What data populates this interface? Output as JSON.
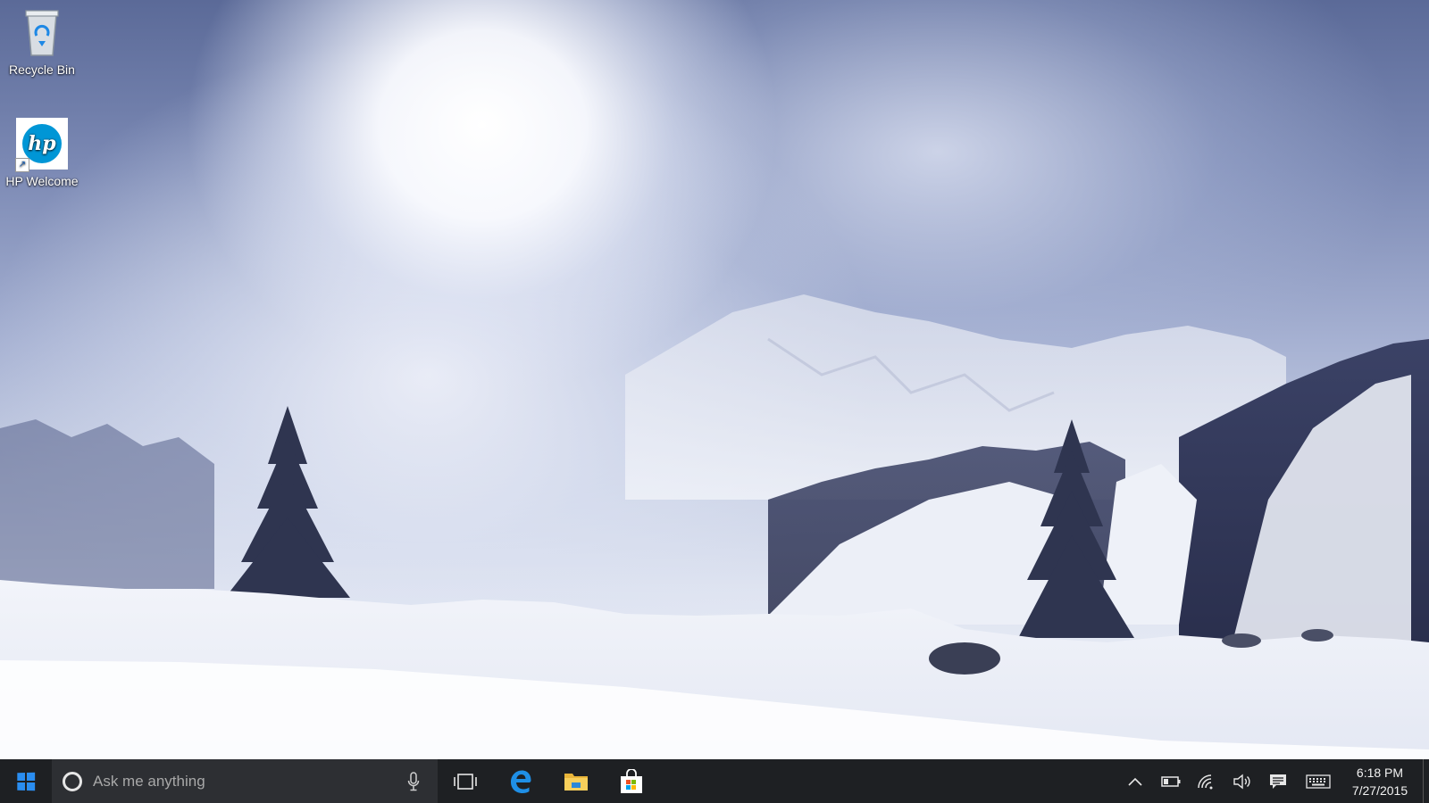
{
  "desktop": {
    "icons": [
      {
        "label": "Recycle Bin",
        "icon": "recycle-bin-icon"
      },
      {
        "label": "HP Welcome",
        "icon": "hp-logo-icon",
        "logo_text": "hp"
      }
    ]
  },
  "taskbar": {
    "search": {
      "placeholder": "Ask me anything"
    },
    "pinned": [
      {
        "name": "task-view",
        "icon": "task-view-icon"
      },
      {
        "name": "edge",
        "icon": "edge-icon"
      },
      {
        "name": "file-explorer",
        "icon": "folder-icon"
      },
      {
        "name": "store",
        "icon": "store-icon"
      }
    ],
    "tray": [
      "chevron-up-icon",
      "battery-icon",
      "wifi-icon",
      "volume-icon",
      "action-center-icon",
      "keyboard-icon"
    ],
    "clock": {
      "time": "6:18 PM",
      "date": "7/27/2015"
    }
  },
  "colors": {
    "taskbar_bg": "#1e2023",
    "search_bg": "#2d2f33",
    "accent_blue": "#2a8df0",
    "hp_blue": "#0096d6"
  }
}
